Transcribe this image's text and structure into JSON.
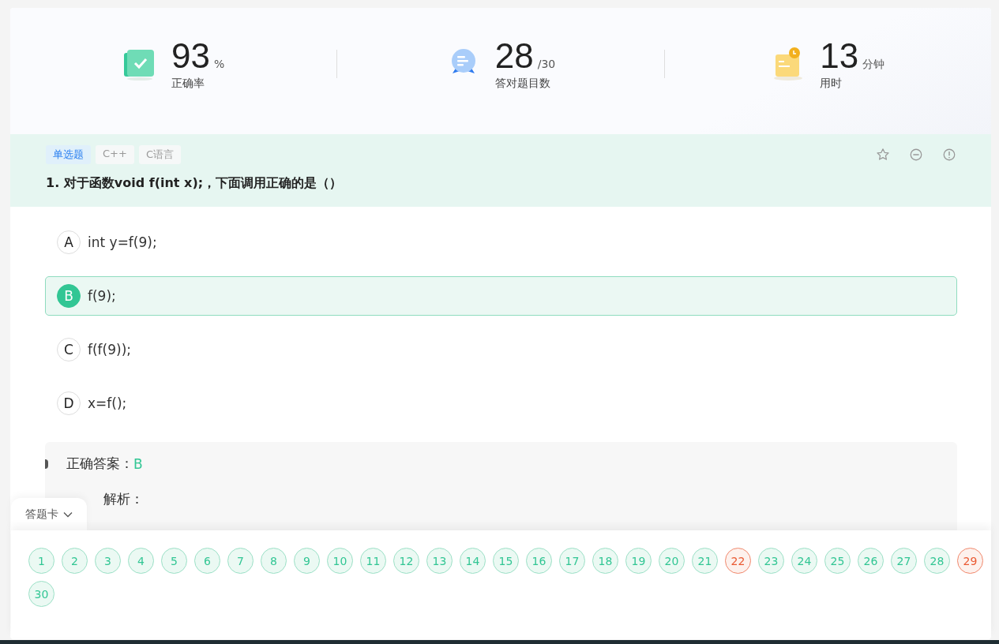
{
  "stats": [
    {
      "kind": "accuracy",
      "value": "93",
      "unit": "%",
      "label": "正确率"
    },
    {
      "kind": "count",
      "value": "28",
      "unit": "/30",
      "label": "答对题目数"
    },
    {
      "kind": "time",
      "value": "13",
      "unit": "分钟",
      "label": "用时"
    }
  ],
  "question": {
    "tags": [
      {
        "label": "单选题",
        "kind": "type"
      },
      {
        "label": "C++",
        "kind": "topic"
      },
      {
        "label": "C语言",
        "kind": "topic"
      }
    ],
    "title": "1. 对于函数void f(int x);，下面调用正确的是（）",
    "options": [
      {
        "letter": "A",
        "text": "int y=f(9);",
        "selected": false
      },
      {
        "letter": "B",
        "text": "f(9);",
        "selected": true
      },
      {
        "letter": "C",
        "text": "f(f(9));",
        "selected": false
      },
      {
        "letter": "D",
        "text": "x=f();",
        "selected": false
      }
    ]
  },
  "answer": {
    "label": "正确答案：",
    "value": "B",
    "analysis_label": "解析："
  },
  "answer_card": {
    "tab": "答题卡",
    "items": [
      {
        "n": "1",
        "correct": true
      },
      {
        "n": "2",
        "correct": true
      },
      {
        "n": "3",
        "correct": true
      },
      {
        "n": "4",
        "correct": true
      },
      {
        "n": "5",
        "correct": true
      },
      {
        "n": "6",
        "correct": true
      },
      {
        "n": "7",
        "correct": true
      },
      {
        "n": "8",
        "correct": true
      },
      {
        "n": "9",
        "correct": true
      },
      {
        "n": "10",
        "correct": true
      },
      {
        "n": "11",
        "correct": true
      },
      {
        "n": "12",
        "correct": true
      },
      {
        "n": "13",
        "correct": true
      },
      {
        "n": "14",
        "correct": true
      },
      {
        "n": "15",
        "correct": true
      },
      {
        "n": "16",
        "correct": true
      },
      {
        "n": "17",
        "correct": true
      },
      {
        "n": "18",
        "correct": true
      },
      {
        "n": "19",
        "correct": true
      },
      {
        "n": "20",
        "correct": true
      },
      {
        "n": "21",
        "correct": true
      },
      {
        "n": "22",
        "correct": false
      },
      {
        "n": "23",
        "correct": true
      },
      {
        "n": "24",
        "correct": true
      },
      {
        "n": "25",
        "correct": true
      },
      {
        "n": "26",
        "correct": true
      },
      {
        "n": "27",
        "correct": true
      },
      {
        "n": "28",
        "correct": true
      },
      {
        "n": "29",
        "correct": false
      },
      {
        "n": "30",
        "correct": true
      }
    ]
  }
}
